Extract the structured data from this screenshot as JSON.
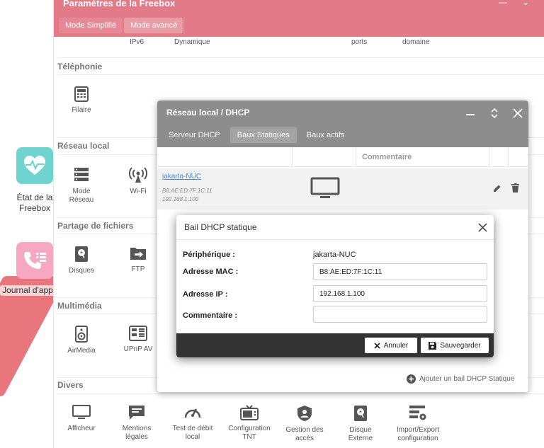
{
  "desktop": {
    "etat_label_1": "État de la",
    "etat_label_2": "Freebox",
    "journal_label": "Journal d'app"
  },
  "settings": {
    "title": "Paramètres de la Freebox",
    "mode_simple": "Mode Simplifié",
    "mode_avance": "Mode avancé",
    "top_cut": [
      "IPv6",
      "Dynamique",
      "ports",
      "domaine"
    ],
    "sections": {
      "telephonie": "Téléphonie",
      "reseau_local": "Réseau local",
      "partage": "Partage de fichiers",
      "multimedia": "Multimédia",
      "divers": "Divers"
    },
    "items": {
      "filaire": "Filaire",
      "mode_reseau_1": "Mode",
      "mode_reseau_2": "Réseau",
      "wifi": "Wi-Fi",
      "disques": "Disques",
      "ftp": "FTP",
      "airmedia": "AirMedia",
      "upnp": "UPnP AV",
      "divers": [
        {
          "l1": "Afficheur",
          "l2": ""
        },
        {
          "l1": "Mentions",
          "l2": "légales"
        },
        {
          "l1": "Test de débit",
          "l2": "local"
        },
        {
          "l1": "Configuration",
          "l2": "TNT"
        },
        {
          "l1": "Gestion des",
          "l2": "accès"
        },
        {
          "l1": "Disque",
          "l2": "Externe"
        },
        {
          "l1": "Import/Export",
          "l2": "configuration"
        }
      ]
    }
  },
  "dhcp": {
    "title": "Réseau local / DHCP",
    "tabs": [
      "Serveur DHCP",
      "Baux Statiques",
      "Baux actifs"
    ],
    "comment_header": "Commentaire",
    "lease": {
      "name": "jakarta-NUC",
      "mac": "B8:AE:ED:7F:1C:11",
      "ip": "192.168.1.100"
    },
    "add_label": "Ajouter un bail DHCP Statique"
  },
  "bail": {
    "title": "Bail DHCP statique",
    "peripherique_label": "Périphérique :",
    "peripherique_value": "jakarta-NUC",
    "mac_label": "Adresse MAC :",
    "mac_value": "B8:AE:ED:7F:1C:11",
    "ip_label": "Adresse IP :",
    "ip_value": "192.168.1.100",
    "comment_label": "Commentaire :",
    "comment_value": "",
    "cancel_label": "Annuler",
    "save_label": "Sauvegarder"
  }
}
